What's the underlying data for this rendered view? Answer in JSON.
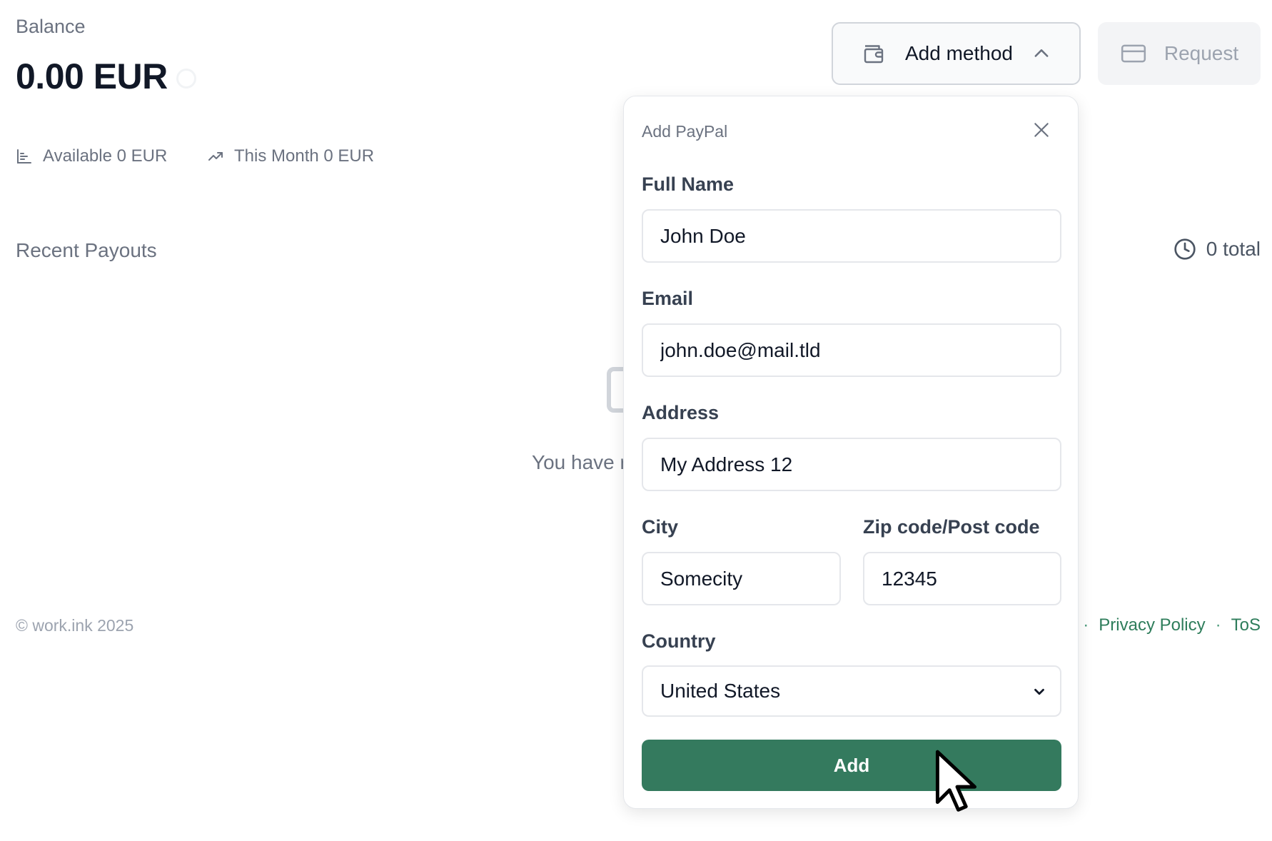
{
  "balance": {
    "label": "Balance",
    "amount": "0.00 EUR"
  },
  "stats": {
    "available": "Available 0 EUR",
    "this_month": "This Month 0 EUR"
  },
  "recent": {
    "title": "Recent Payouts",
    "total": "0 total",
    "empty_text": "You have r"
  },
  "footer": {
    "copyright": "© work.ink 2025",
    "separator": "·",
    "privacy": "Privacy Policy",
    "tos": "ToS"
  },
  "toolbar": {
    "add_method": "Add method",
    "request": "Request"
  },
  "form": {
    "title": "Add PayPal",
    "full_name": {
      "label": "Full Name",
      "value": "John Doe"
    },
    "email": {
      "label": "Email",
      "value": "john.doe@mail.tld"
    },
    "address": {
      "label": "Address",
      "value": "My Address 12"
    },
    "city": {
      "label": "City",
      "value": "Somecity"
    },
    "zip": {
      "label": "Zip code/Post code",
      "value": "12345"
    },
    "country": {
      "label": "Country",
      "value": "United States"
    },
    "submit": "Add"
  },
  "colors": {
    "primary": "#347a5e",
    "link": "#2e7d5b"
  },
  "icons": [
    "wallet-icon",
    "chevron-up-icon",
    "card-icon",
    "bar-chart-icon",
    "trend-up-icon",
    "clock-icon",
    "close-icon",
    "chevron-down-icon",
    "cursor-icon"
  ]
}
